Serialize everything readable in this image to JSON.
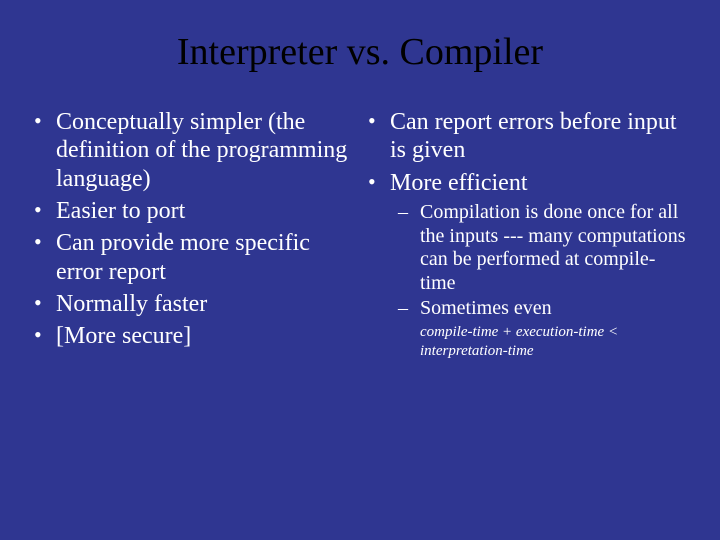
{
  "title": "Interpreter vs. Compiler",
  "left": {
    "items": [
      "Conceptually simpler (the definition of the programming language)",
      "Easier to port",
      "Can provide more specific error report",
      "Normally faster",
      "[More secure]"
    ]
  },
  "right": {
    "items": [
      "Can report errors before input is given",
      "More efficient"
    ],
    "sub": [
      "Compilation is done once for all the inputs --- many computations can be performed at compile-time",
      "Sometimes even"
    ],
    "subnote": "compile-time + execution-time < interpretation-time"
  }
}
